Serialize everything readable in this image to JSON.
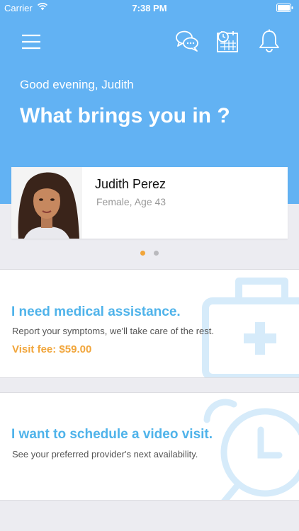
{
  "status_bar": {
    "carrier": "Carrier",
    "time": "7:38 PM"
  },
  "toolbar": {
    "menu_icon": "hamburger-menu-icon",
    "chat_icon": "chat-bubbles-icon",
    "calendar_icon": "calendar-clock-icon",
    "bell_icon": "notification-bell-icon"
  },
  "header": {
    "greeting": "Good evening, Judith",
    "headline": "What brings you in ?"
  },
  "profile": {
    "name": "Judith Perez",
    "meta": "Female, Age 43"
  },
  "pager": {
    "count": 2,
    "active_index": 0
  },
  "options": [
    {
      "title": "I need medical assistance.",
      "subtitle": "Report your symptoms, we'll take care of the rest.",
      "fee": "Visit fee: $59.00",
      "icon": "medical-kit-icon"
    },
    {
      "title": "I want to schedule a video visit.",
      "subtitle": "See your preferred provider's next availability.",
      "icon": "alarm-clock-icon"
    }
  ],
  "colors": {
    "header_bg": "#62b2f3",
    "accent_blue": "#4fb3ea",
    "accent_orange": "#f1a53a",
    "page_bg": "#ececf1"
  }
}
